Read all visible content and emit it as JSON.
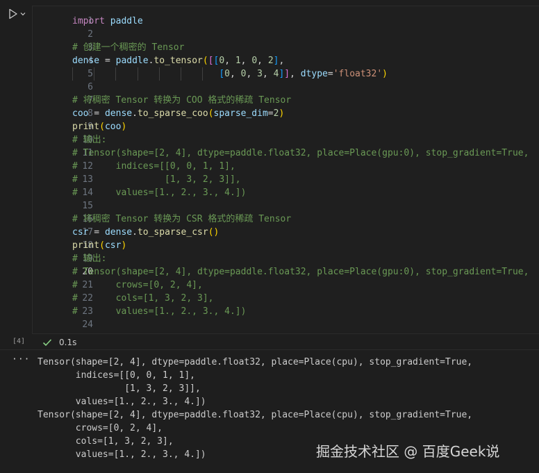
{
  "cell": {
    "execution_count": "[4]",
    "run_icon": "play-icon",
    "run_menu_icon": "chevron-down-icon",
    "status_icon": "checkmark-icon",
    "duration": "0.1s",
    "active_line": 20,
    "lines": [
      [
        {
          "t": "import",
          "c": "kw"
        },
        {
          "t": " paddle",
          "c": "id"
        }
      ],
      [],
      [
        {
          "t": "# 创建一个稠密的 Tensor",
          "c": "com"
        }
      ],
      [
        {
          "t": "dense",
          "c": "id"
        },
        {
          "t": " = ",
          "c": "op"
        },
        {
          "t": "paddle",
          "c": "id"
        },
        {
          "t": ".",
          "c": "op"
        },
        {
          "t": "to_tensor",
          "c": "fn"
        },
        {
          "t": "(",
          "c": "b1"
        },
        {
          "t": "[",
          "c": "b2"
        },
        {
          "t": "[",
          "c": "b3"
        },
        {
          "t": "0",
          "c": "num"
        },
        {
          "t": ", ",
          "c": "op"
        },
        {
          "t": "1",
          "c": "num"
        },
        {
          "t": ", ",
          "c": "op"
        },
        {
          "t": "0",
          "c": "num"
        },
        {
          "t": ", ",
          "c": "op"
        },
        {
          "t": "2",
          "c": "num"
        },
        {
          "t": "]",
          "c": "b3"
        },
        {
          "t": ",",
          "c": "op"
        }
      ],
      [
        {
          "t": "                           ",
          "c": "op"
        },
        {
          "t": "[",
          "c": "b3"
        },
        {
          "t": "0",
          "c": "num"
        },
        {
          "t": ", ",
          "c": "op"
        },
        {
          "t": "0",
          "c": "num"
        },
        {
          "t": ", ",
          "c": "op"
        },
        {
          "t": "3",
          "c": "num"
        },
        {
          "t": ", ",
          "c": "op"
        },
        {
          "t": "4",
          "c": "num"
        },
        {
          "t": "]",
          "c": "b3"
        },
        {
          "t": "]",
          "c": "b2"
        },
        {
          "t": ", ",
          "c": "op"
        },
        {
          "t": "dtype",
          "c": "id"
        },
        {
          "t": "=",
          "c": "op"
        },
        {
          "t": "'float32'",
          "c": "str"
        },
        {
          "t": ")",
          "c": "b1"
        }
      ],
      [],
      [
        {
          "t": "# 将稠密 Tensor 转换为 COO 格式的稀疏 Tensor",
          "c": "com"
        }
      ],
      [
        {
          "t": "coo",
          "c": "id"
        },
        {
          "t": " = ",
          "c": "op"
        },
        {
          "t": "dense",
          "c": "id"
        },
        {
          "t": ".",
          "c": "op"
        },
        {
          "t": "to_sparse_coo",
          "c": "fn"
        },
        {
          "t": "(",
          "c": "b1"
        },
        {
          "t": "sparse_dim",
          "c": "id"
        },
        {
          "t": "=",
          "c": "op"
        },
        {
          "t": "2",
          "c": "num"
        },
        {
          "t": ")",
          "c": "b1"
        }
      ],
      [
        {
          "t": "print",
          "c": "fn"
        },
        {
          "t": "(",
          "c": "b1"
        },
        {
          "t": "coo",
          "c": "id"
        },
        {
          "t": ")",
          "c": "b1"
        }
      ],
      [
        {
          "t": "# 输出:",
          "c": "com"
        }
      ],
      [
        {
          "t": "# Tensor(shape=[2, 4], dtype=paddle.float32, place=Place(gpu:0), stop_gradient=True,",
          "c": "com"
        }
      ],
      [
        {
          "t": "#       indices=[[0, 0, 1, 1],",
          "c": "com"
        }
      ],
      [
        {
          "t": "#                [1, 3, 2, 3]],",
          "c": "com"
        }
      ],
      [
        {
          "t": "#       values=[1., 2., 3., 4.])",
          "c": "com"
        }
      ],
      [],
      [
        {
          "t": "# 将稠密 Tensor 转换为 CSR 格式的稀疏 Tensor",
          "c": "com"
        }
      ],
      [
        {
          "t": "csr",
          "c": "id"
        },
        {
          "t": " = ",
          "c": "op"
        },
        {
          "t": "dense",
          "c": "id"
        },
        {
          "t": ".",
          "c": "op"
        },
        {
          "t": "to_sparse_csr",
          "c": "fn"
        },
        {
          "t": "(",
          "c": "b1"
        },
        {
          "t": ")",
          "c": "b1"
        }
      ],
      [
        {
          "t": "print",
          "c": "fn"
        },
        {
          "t": "(",
          "c": "b1"
        },
        {
          "t": "csr",
          "c": "id"
        },
        {
          "t": ")",
          "c": "b1"
        }
      ],
      [
        {
          "t": "# 输出:",
          "c": "com"
        }
      ],
      [
        {
          "t": "# Tensor(shape=[2, 4], dtype=paddle.float32, place=Place(gpu:0), stop_gradient=True,",
          "c": "com"
        }
      ],
      [
        {
          "t": "#       crows=[0, 2, 4],",
          "c": "com"
        }
      ],
      [
        {
          "t": "#       cols=[1, 3, 2, 3],",
          "c": "com"
        }
      ],
      [
        {
          "t": "#       values=[1., 2., 3., 4.])",
          "c": "com"
        }
      ],
      []
    ]
  },
  "output": {
    "menu_label": "···",
    "lines": [
      "Tensor(shape=[2, 4], dtype=paddle.float32, place=Place(cpu), stop_gradient=True,",
      "       indices=[[0, 0, 1, 1],",
      "                [1, 3, 2, 3]],",
      "       values=[1., 2., 3., 4.])",
      "Tensor(shape=[2, 4], dtype=paddle.float32, place=Place(cpu), stop_gradient=True,",
      "       crows=[0, 2, 4],",
      "       cols=[1, 3, 2, 3],",
      "       values=[1., 2., 3., 4.])"
    ]
  },
  "watermark": "掘金技术社区 @ 百度Geek说"
}
